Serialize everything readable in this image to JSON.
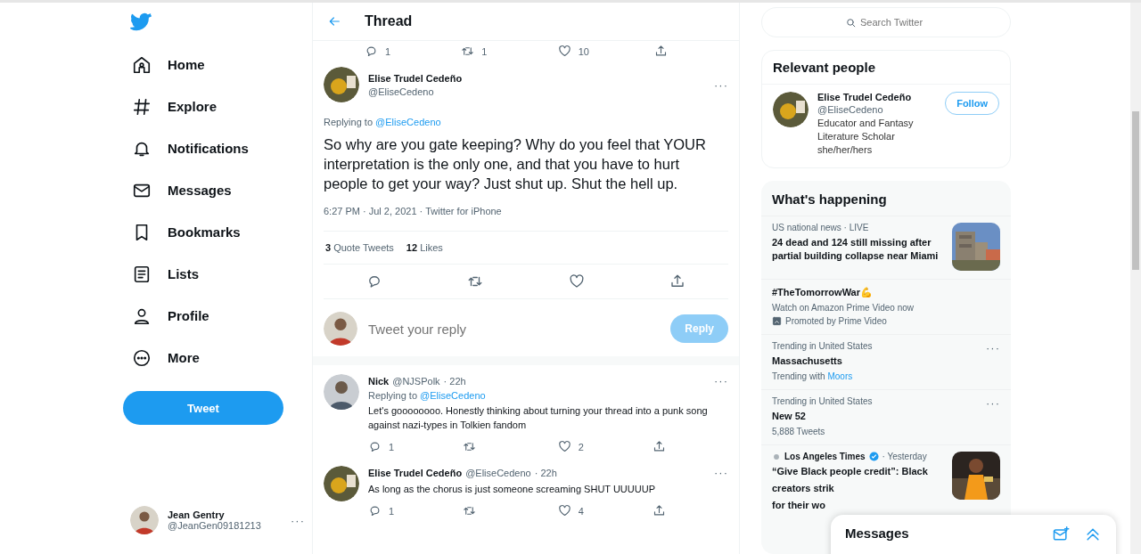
{
  "nav": {
    "items": [
      {
        "label": "Home",
        "selected": false
      },
      {
        "label": "Explore",
        "selected": false
      },
      {
        "label": "Notifications",
        "selected": false
      },
      {
        "label": "Messages",
        "selected": false
      },
      {
        "label": "Bookmarks",
        "selected": false
      },
      {
        "label": "Lists",
        "selected": false
      },
      {
        "label": "Profile",
        "selected": false
      },
      {
        "label": "More",
        "selected": false
      }
    ],
    "tweet_button": "Tweet",
    "account": {
      "name": "Jean Gentry",
      "handle": "@JeanGen09181213",
      "more": "···"
    }
  },
  "thread": {
    "title": "Thread",
    "previous_actions": {
      "reply": "1",
      "retweet": "1",
      "like": "10"
    },
    "main": {
      "name": "Elise Trudel Cedeño",
      "handle": "@EliseCedeno",
      "more": "···",
      "replying_label": "Replying to",
      "replying_to": "@EliseCedeno",
      "text": "So why are you gate keeping? Why do you feel that YOUR interpretation is the only one, and that you have to hurt people to get your way? Just shut up. Shut the hell up.",
      "meta": "6:27 PM · Jul 2, 2021 · Twitter for iPhone",
      "stats": [
        {
          "count": "3",
          "label": "Quote Tweets"
        },
        {
          "count": "12",
          "label": "Likes"
        }
      ]
    },
    "composer": {
      "placeholder": "Tweet your reply",
      "button": "Reply",
      "disabled": true
    },
    "replies": [
      {
        "name": "Nick",
        "handle": "@NJSPolk",
        "time": "· 22h",
        "more": "···",
        "replying_label": "Replying to",
        "replying_to": "@EliseCedeno",
        "text": "Let's goooooooo. Honestly thinking about turning your thread into a punk song against nazi-types in Tolkien fandom",
        "actions": {
          "reply": "1",
          "like": "2"
        }
      },
      {
        "name": "Elise Trudel Cedeño",
        "handle": "@EliseCedeno",
        "time": "· 22h",
        "more": "···",
        "text": "As long as the chorus is just someone screaming SHUT UUUUUP",
        "actions": {
          "reply": "1",
          "like": "4"
        }
      }
    ]
  },
  "sidebar": {
    "search": {
      "placeholder": "Search Twitter"
    },
    "relevant": {
      "title": "Relevant people",
      "name": "Elise Trudel Cedeño",
      "handle": "@EliseCedeno",
      "bio": "Educator and Fantasy Literature Scholar she/her/hers",
      "follow": "Follow"
    },
    "happening": {
      "title": "What's happening",
      "items": [
        {
          "kind": "news",
          "context": "US national news · LIVE",
          "lines": [
            "24 dead and 124 still missing after partial building collapse near Miami"
          ]
        },
        {
          "kind": "promoted",
          "title": "#TheTomorrowWar💪",
          "description": "Watch on Amazon Prime Video now",
          "promoted": "Promoted by Prime Video"
        },
        {
          "kind": "trend",
          "context": "Trending in United States",
          "title": "Massachusetts",
          "sub": "Trending with",
          "link": "Moors",
          "more": "···"
        },
        {
          "kind": "trend",
          "context": "Trending in United States",
          "title": "New 52",
          "sub": "5,888 Tweets",
          "more": "···"
        },
        {
          "kind": "source",
          "source": "Los Angeles Times",
          "verified": true,
          "time": "· Yesterday",
          "lines": [
            "“Give Black people credit”: Black",
            "creators strik",
            "for their wo"
          ]
        }
      ]
    }
  },
  "messages_drawer": {
    "title": "Messages"
  }
}
